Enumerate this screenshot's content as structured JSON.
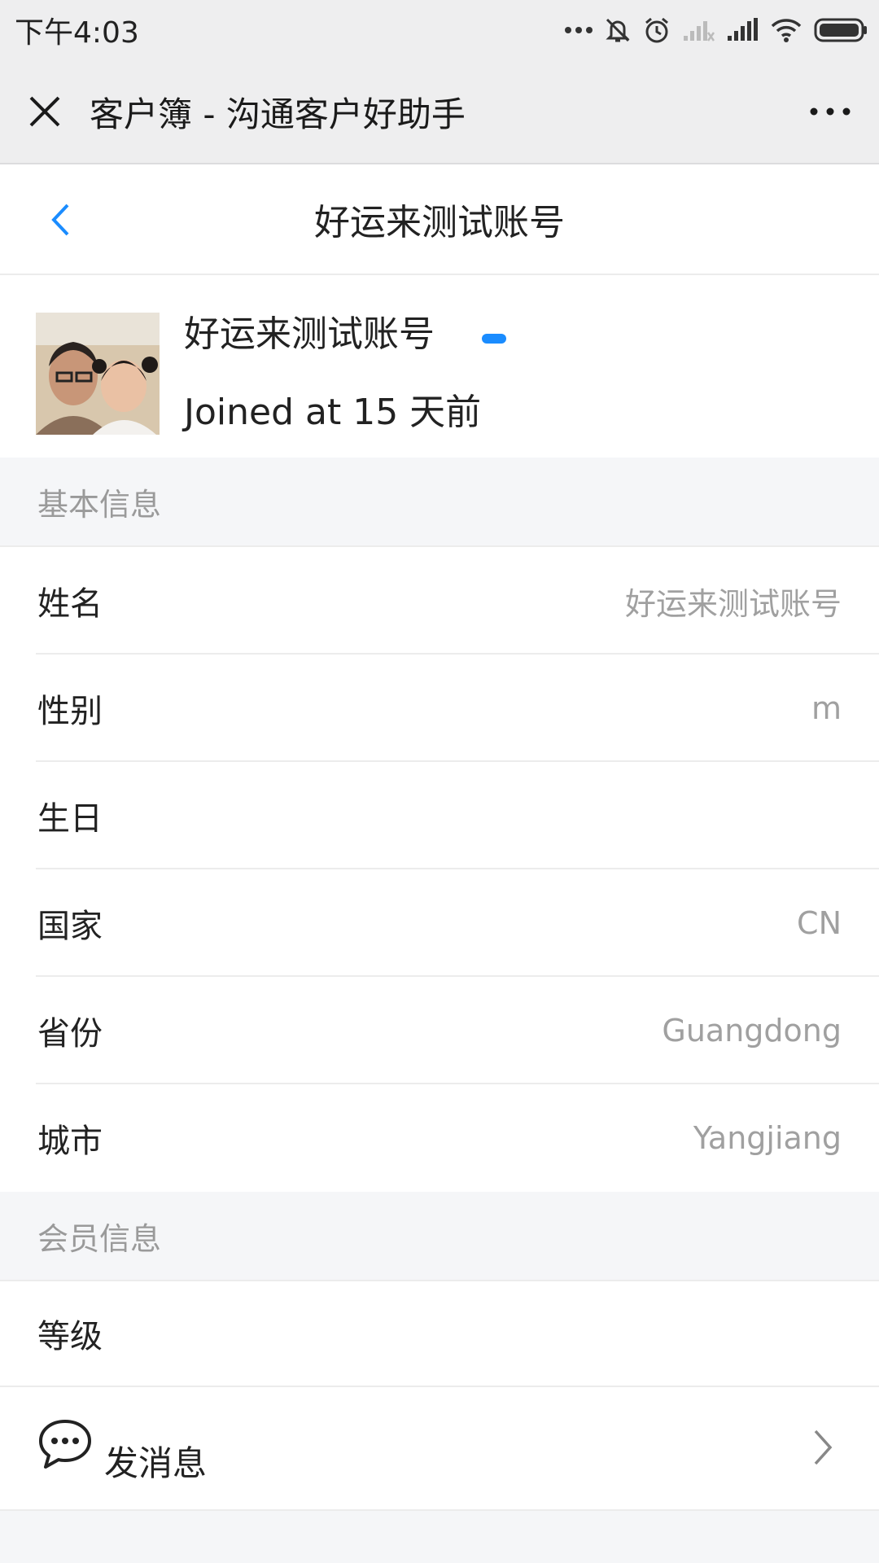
{
  "status_bar": {
    "time": "下午4:03",
    "icons": [
      "more-dots-icon",
      "mute-icon",
      "alarm-icon",
      "sim1-signal-icon",
      "signal-icon",
      "wifi-icon",
      "battery-icon"
    ]
  },
  "title_bar": {
    "title": "客户簿 - 沟通客户好助手",
    "close_icon": "close-icon",
    "more_icon": "more-icon"
  },
  "nav": {
    "title": "好运来测试账号",
    "back_icon": "chevron-left-icon",
    "accent_color": "#1a8cff"
  },
  "profile": {
    "name": "好运来测试账号",
    "joined": "Joined at 15 天前"
  },
  "basic_info": {
    "header": "基本信息",
    "rows": [
      {
        "label": "姓名",
        "value": "好运来测试账号"
      },
      {
        "label": "性别",
        "value": "m"
      },
      {
        "label": "生日",
        "value": ""
      },
      {
        "label": "国家",
        "value": "CN"
      },
      {
        "label": "省份",
        "value": "Guangdong"
      },
      {
        "label": "城市",
        "value": "Yangjiang"
      }
    ]
  },
  "member_info": {
    "header": "会员信息",
    "rows": [
      {
        "label": "等级",
        "value": ""
      }
    ]
  },
  "actions": {
    "send_message": "发消息",
    "message_icon": "chat-bubble-icon",
    "chevron_icon": "chevron-right-icon"
  }
}
